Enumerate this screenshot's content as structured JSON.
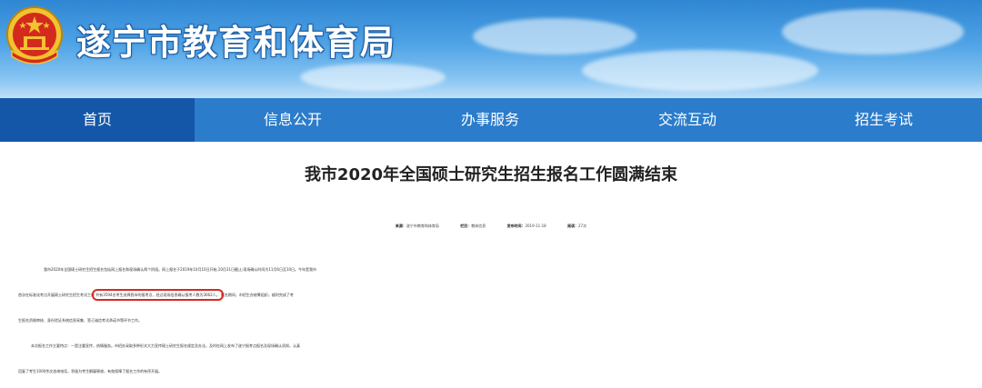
{
  "header": {
    "site_title": "遂宁市教育和体育局",
    "emblem_icon": "national-emblem-icon"
  },
  "nav": {
    "items": [
      {
        "label": "首页",
        "active": true
      },
      {
        "label": "信息公开",
        "active": false
      },
      {
        "label": "办事服务",
        "active": false
      },
      {
        "label": "交流互动",
        "active": false
      },
      {
        "label": "招生考试",
        "active": false
      }
    ]
  },
  "article": {
    "title": "我市2020年全国硕士研究生招生报名工作圆满结束",
    "meta": {
      "source_label": "来源：",
      "source_value": "遂宁市教育和体育局",
      "column_label": "栏目：",
      "column_value": "教体信息",
      "date_label": "发布时间：",
      "date_value": "2019-11-18",
      "views_label": "阅读：",
      "views_value": "27次"
    },
    "paragraphs": {
      "p1_line1": "我市2020年全国硕士研究生招生报名包括网上报名和现场确认两个阶段。网上报名于2019年10月10日开始,10月31日截止;现场确认时间为11月6日至10日。今年是我市",
      "p1_line2_before": "首次在标准化考点开展硕士研究生招生考试工作",
      "p1_line2_highlight": "共有3594名考生选择我市的报考点，经过现场信息确认报考人数为3062人。",
      "p1_line2_after": "报名期间，市招生办统筹组织，顺利完成了考",
      "p1_line3": "生报名资格审核、身份验证系统信息采集、签订诚信考试承诺书等环节工作。",
      "p2_line1": "本次报名工作主要特点：一是注重宣传，热情服务。市招办采取多种形式大力宣传硕士研究生报名规定及办法，及时在网上发布了遂宁报考点报名及现场确认须知，认真",
      "p2_line2": "回复了考生1000余次咨询电话，积极为考生解疑释惑，有效保障了报名工作的有序开展。"
    }
  },
  "colors": {
    "nav_bg": "#2b7ccb",
    "nav_active_bg": "#1457a8",
    "highlight_border": "#d82a22"
  }
}
